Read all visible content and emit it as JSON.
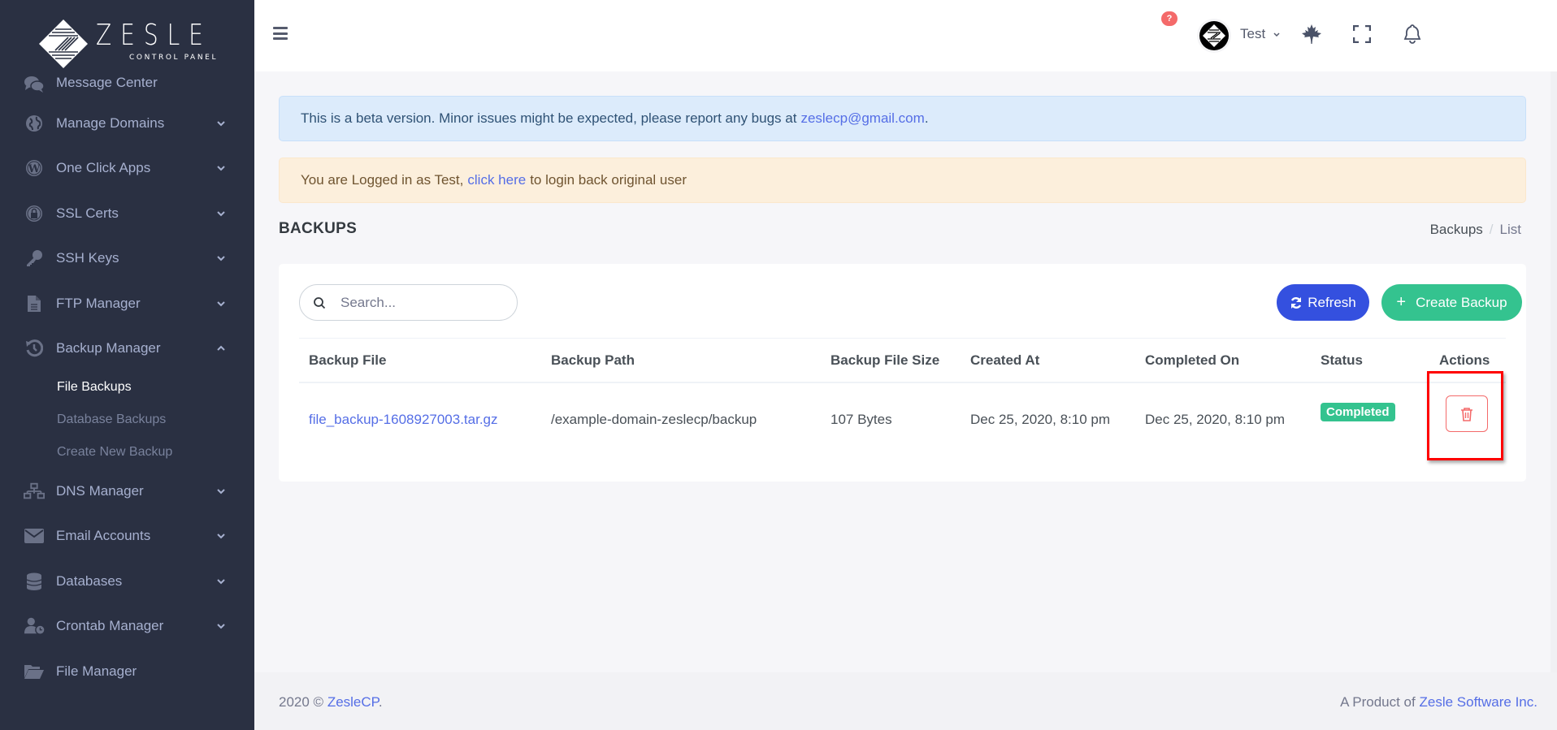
{
  "brand": {
    "name": "ZESLE",
    "subtitle": "CONTROL PANEL"
  },
  "sidebar": {
    "items": [
      {
        "label": "Message Center",
        "icon": "comments-icon",
        "has_chevron": false
      },
      {
        "label": "Manage Domains",
        "icon": "globe-icon",
        "has_chevron": true
      },
      {
        "label": "One Click Apps",
        "icon": "wordpress-icon",
        "has_chevron": true
      },
      {
        "label": "SSL Certs",
        "icon": "lock-icon",
        "has_chevron": true
      },
      {
        "label": "SSH Keys",
        "icon": "key-icon",
        "has_chevron": true
      },
      {
        "label": "FTP Manager",
        "icon": "file-icon",
        "has_chevron": true
      },
      {
        "label": "Backup Manager",
        "icon": "history-icon",
        "has_chevron": true,
        "expanded": true,
        "children": [
          {
            "label": "File Backups",
            "active": true
          },
          {
            "label": "Database Backups",
            "active": false
          },
          {
            "label": "Create New Backup",
            "active": false
          }
        ]
      },
      {
        "label": "DNS Manager",
        "icon": "sitemap-icon",
        "has_chevron": true
      },
      {
        "label": "Email Accounts",
        "icon": "envelope-icon",
        "has_chevron": true
      },
      {
        "label": "Databases",
        "icon": "database-icon",
        "has_chevron": true
      },
      {
        "label": "Crontab Manager",
        "icon": "user-clock-icon",
        "has_chevron": true
      },
      {
        "label": "File Manager",
        "icon": "folder-open-icon",
        "has_chevron": false
      }
    ]
  },
  "header": {
    "notification_badge": "?",
    "user_name": "Test",
    "icons": [
      "menu-icon",
      "maple-leaf-icon",
      "fullscreen-icon",
      "bell-icon"
    ]
  },
  "alerts": {
    "beta": {
      "text": "This is a beta version. Minor issues might be expected, please report any bugs at",
      "link": "zeslecp@gmail.com",
      "suffix": "."
    },
    "login": {
      "text": "You are Logged in as Test,",
      "link": "click here",
      "suffix": "to login back original user"
    }
  },
  "page": {
    "title": "BACKUPS",
    "breadcrumb": [
      "Backups",
      "List"
    ]
  },
  "toolbar": {
    "search_placeholder": "Search...",
    "refresh_label": "Refresh",
    "create_label": "Create Backup"
  },
  "table": {
    "columns": [
      "Backup File",
      "Backup Path",
      "Backup File Size",
      "Created At",
      "Completed On",
      "Status",
      "Actions"
    ],
    "rows": [
      {
        "file": "file_backup-1608927003.tar.gz",
        "path": "/example-domain-zeslecp/backup",
        "size": "107 Bytes",
        "created_at": "Dec 25, 2020, 8:10 pm",
        "completed_on": "Dec 25, 2020, 8:10 pm",
        "status": "Completed"
      }
    ]
  },
  "footer": {
    "left_prefix": "2020 ©",
    "left_link": "ZesleCP",
    "left_suffix": ".",
    "right_prefix": "A Product of",
    "right_link": "Zesle Software Inc."
  },
  "colors": {
    "sidebar_bg": "#2a3042",
    "primary": "#556ee6",
    "refresh_button": "#3450df",
    "success": "#34c38f",
    "danger": "#f46a6a"
  }
}
